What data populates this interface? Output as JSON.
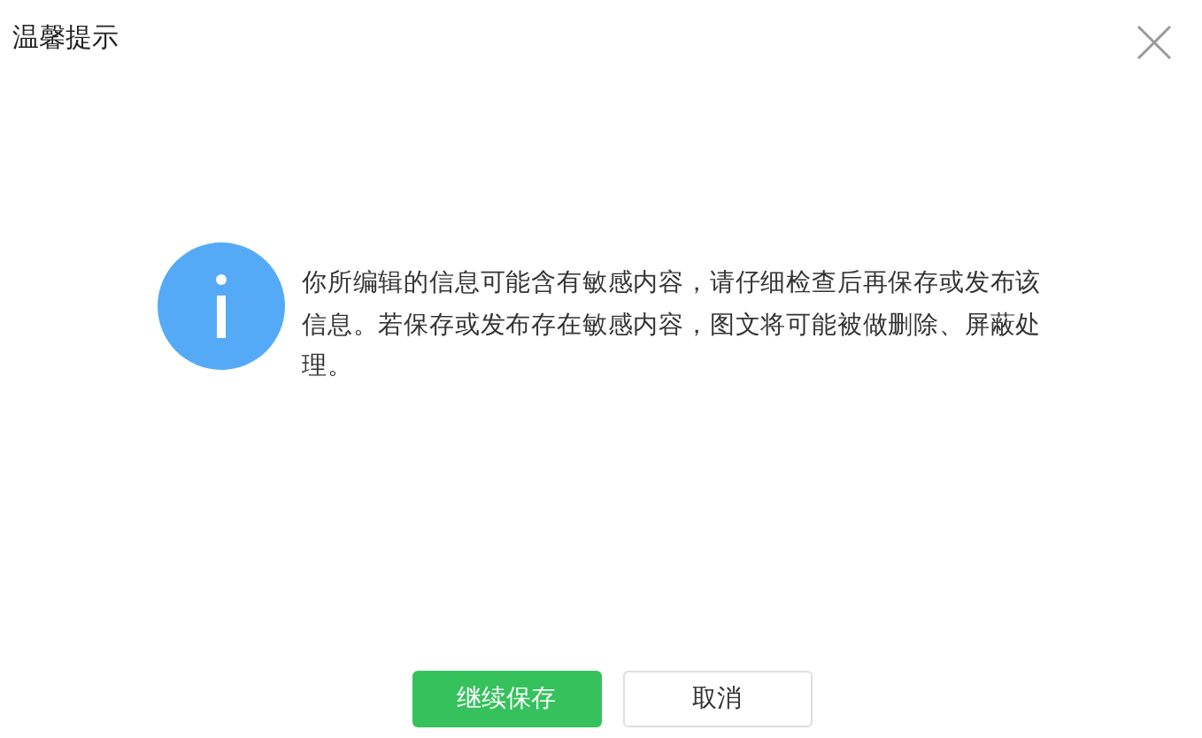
{
  "dialog": {
    "title": "温馨提示",
    "message": "你所编辑的信息可能含有敏感内容，请仔细检查后再保存或发布该信息。若保存或发布存在敏感内容，图文将可能被做删除、屏蔽处理。",
    "buttons": [
      {
        "label": "继续保存",
        "kind": "primary"
      },
      {
        "label": "取消",
        "kind": "secondary"
      }
    ]
  }
}
